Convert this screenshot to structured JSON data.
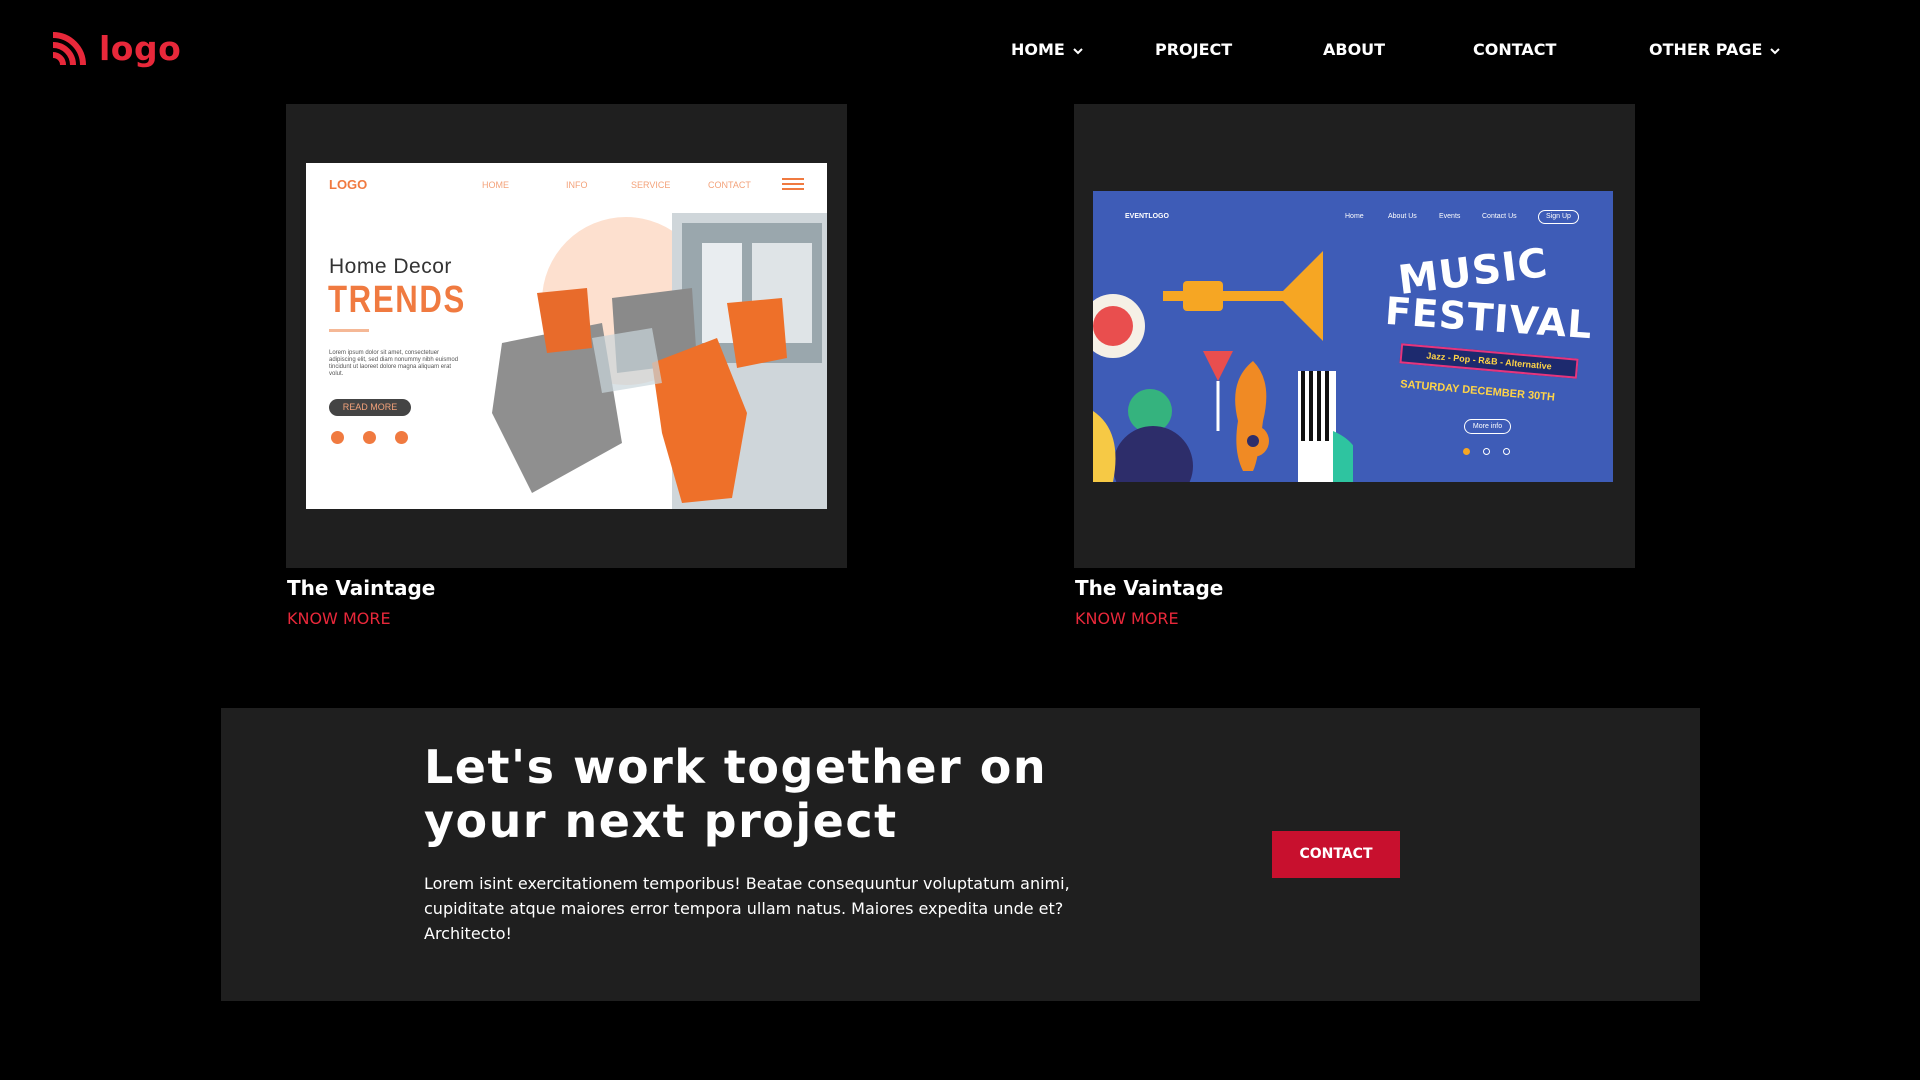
{
  "brand": {
    "logo_text": "logo",
    "accent_color": "#e8283a"
  },
  "nav": {
    "items": [
      {
        "label": "HOME",
        "dropdown": true
      },
      {
        "label": "PROJECT",
        "dropdown": false
      },
      {
        "label": "ABOUT",
        "dropdown": false
      },
      {
        "label": "CONTACT",
        "dropdown": false
      },
      {
        "label": "OTHER PAGE",
        "dropdown": true
      }
    ]
  },
  "projects": [
    {
      "title": "The Vaintage",
      "link_label": "KNOW MORE",
      "mockup": {
        "logo": "LOGO",
        "nav": [
          "HOME",
          "INFO",
          "SERVICE",
          "CONTACT"
        ],
        "heading": "Home  Decor",
        "subheading": "TRENDS",
        "paragraph": "Lorem ipsum dolor sit amet, consectetuer adipiscing elit, sed diam nonummy nibh euismod tincidunt ut laoreet dolore magna aliquam erat volut.",
        "button": "READ MORE",
        "accent_color": "#f07a40"
      }
    },
    {
      "title": "The Vaintage",
      "link_label": "KNOW MORE",
      "mockup": {
        "logo": "EVENTLOGO",
        "nav": [
          "Home",
          "About Us",
          "Events",
          "Contact Us"
        ],
        "signup": "Sign Up",
        "title_line1": "MUSIC",
        "title_line2": "FESTIVAL",
        "genres": "Jazz - Pop - R&B - Alternative",
        "date": "SATURDAY DECEMBER 30TH",
        "button": "More info",
        "bg_color": "#3e5cb7"
      }
    }
  ],
  "cta": {
    "title": "Let's work together on your next project",
    "text": "Lorem isint exercitationem temporibus! Beatae consequuntur voluptatum animi, cupiditate atque maiores error tempora ullam natus. Maiores expedita unde et? Architecto!",
    "button": "CONTACT",
    "button_color": "#c8102e"
  }
}
